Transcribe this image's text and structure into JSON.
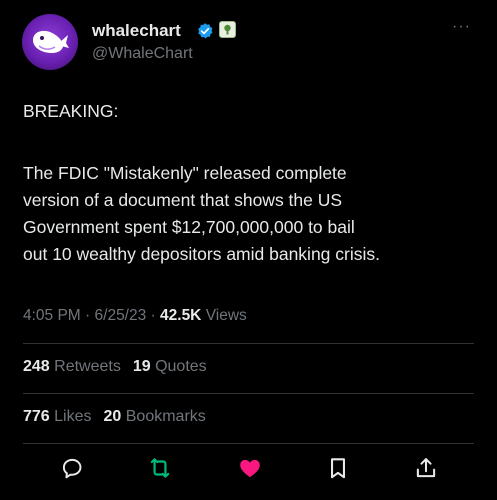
{
  "author": {
    "display_name": "whalechart",
    "handle": "@WhaleChart"
  },
  "more_label": "···",
  "tweet": {
    "line1": "BREAKING:",
    "body_lines": [
      "The FDIC \"Mistakenly\" released complete",
      "version of a document that shows the US",
      "Government spent $12,700,000,000 to bail",
      "out 10 wealthy depositors amid banking crisis."
    ]
  },
  "meta": {
    "time": "4:05 PM",
    "sep1": " · ",
    "date": "6/25/23",
    "sep2": " · ",
    "views_count": "42.5K",
    "views_label": " Views"
  },
  "stats": {
    "retweets_count": "248",
    "retweets_label": " Retweets",
    "quotes_count": "19",
    "quotes_label": " Quotes",
    "likes_count": "776",
    "likes_label": " Likes",
    "bookmarks_count": "20",
    "bookmarks_label": " Bookmarks"
  },
  "icons": {
    "verified": "verified-badge-icon",
    "affiliate": "affiliate-badge-icon",
    "reply": "reply-icon",
    "retweet": "retweet-icon",
    "like": "like-icon",
    "bookmark": "bookmark-icon",
    "share": "share-icon"
  },
  "colors": {
    "background": "#000000",
    "text": "#e7e9ea",
    "muted": "#71767b",
    "verified": "#1d9bf0",
    "retweeted": "#00ba7c",
    "liked": "#f91880",
    "avatar": "#6a20b3"
  }
}
